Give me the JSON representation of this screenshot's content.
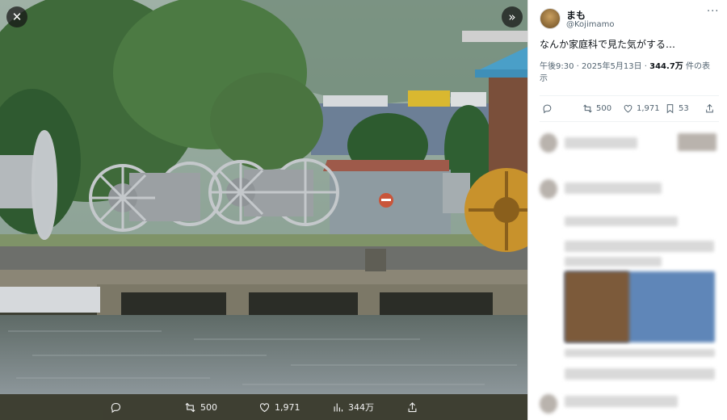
{
  "viewer": {
    "close_icon": "close-icon",
    "expand_icon": "double-chevron-right-icon",
    "actions": {
      "reply_icon": "reply-icon",
      "retweet_icon": "retweet-icon",
      "retweet_count": "500",
      "like_icon": "heart-icon",
      "like_count": "1,971",
      "views_icon": "bar-chart-icon",
      "views_count": "344万",
      "share_icon": "share-icon"
    }
  },
  "tweet": {
    "display_name": "まも",
    "handle": "@Kojimamo",
    "more_label": "···",
    "text": "なんか家庭科で見た気がする…",
    "time": "午後9:30",
    "separator": "·",
    "date": "2025年5月13日",
    "views_value": "344.7万",
    "views_suffix_line1": " 件の表",
    "views_suffix_line2": "示",
    "actions": {
      "reply_icon": "reply-icon",
      "retweet_count": "500",
      "like_count": "1,971",
      "bookmark_count": "53",
      "share_icon": "share-icon"
    }
  },
  "colors": {
    "viewer_bg": "#3d3f33",
    "text_primary": "#0f1419",
    "text_secondary": "#536471"
  }
}
